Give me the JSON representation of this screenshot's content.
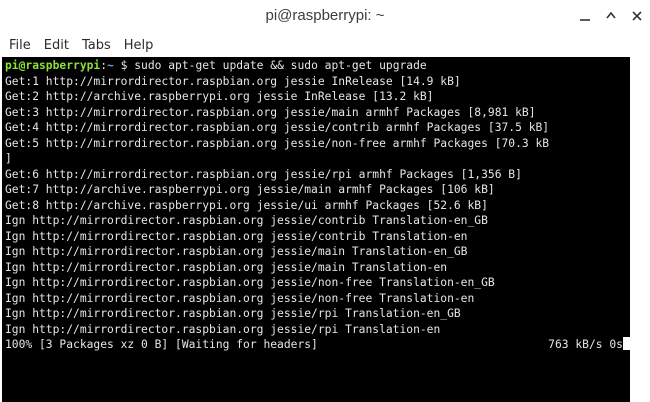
{
  "window": {
    "title": "pi@raspberrypi: ~"
  },
  "menu": [
    "File",
    "Edit",
    "Tabs",
    "Help"
  ],
  "terminal": {
    "prompt_user": "pi@raspberrypi",
    "prompt_sep": ":",
    "prompt_path": "~",
    "prompt_symbol": " $ ",
    "command": "sudo apt-get update && sudo apt-get upgrade",
    "lines": [
      "Get:1 http://mirrordirector.raspbian.org jessie InRelease [14.9 kB]",
      "Get:2 http://archive.raspberrypi.org jessie InRelease [13.2 kB]",
      "Get:3 http://mirrordirector.raspbian.org jessie/main armhf Packages [8,981 kB]",
      "Get:4 http://mirrordirector.raspbian.org jessie/contrib armhf Packages [37.5 kB]",
      "Get:5 http://mirrordirector.raspbian.org jessie/non-free armhf Packages [70.3 kB",
      "]",
      "Get:6 http://mirrordirector.raspbian.org jessie/rpi armhf Packages [1,356 B]",
      "Get:7 http://archive.raspberrypi.org jessie/main armhf Packages [106 kB]",
      "Get:8 http://archive.raspberrypi.org jessie/ui armhf Packages [52.6 kB]",
      "Ign http://mirrordirector.raspbian.org jessie/contrib Translation-en_GB",
      "Ign http://mirrordirector.raspbian.org jessie/contrib Translation-en",
      "Ign http://mirrordirector.raspbian.org jessie/main Translation-en_GB",
      "Ign http://mirrordirector.raspbian.org jessie/main Translation-en",
      "Ign http://mirrordirector.raspbian.org jessie/non-free Translation-en_GB",
      "Ign http://mirrordirector.raspbian.org jessie/non-free Translation-en",
      "Ign http://mirrordirector.raspbian.org jessie/rpi Translation-en_GB",
      "Ign http://mirrordirector.raspbian.org jessie/rpi Translation-en"
    ],
    "progress_left": "100% [3 Packages xz 0 B] [Waiting for headers]",
    "progress_right": "763 kB/s 0s"
  },
  "icons": {
    "minimize": "minimize-icon",
    "maximize": "maximize-icon",
    "close": "close-icon"
  },
  "colors": {
    "terminal_bg": "#000000",
    "terminal_fg": "#e6e6e6",
    "prompt_user": "#8ae234",
    "prompt_path": "#729fcf"
  }
}
